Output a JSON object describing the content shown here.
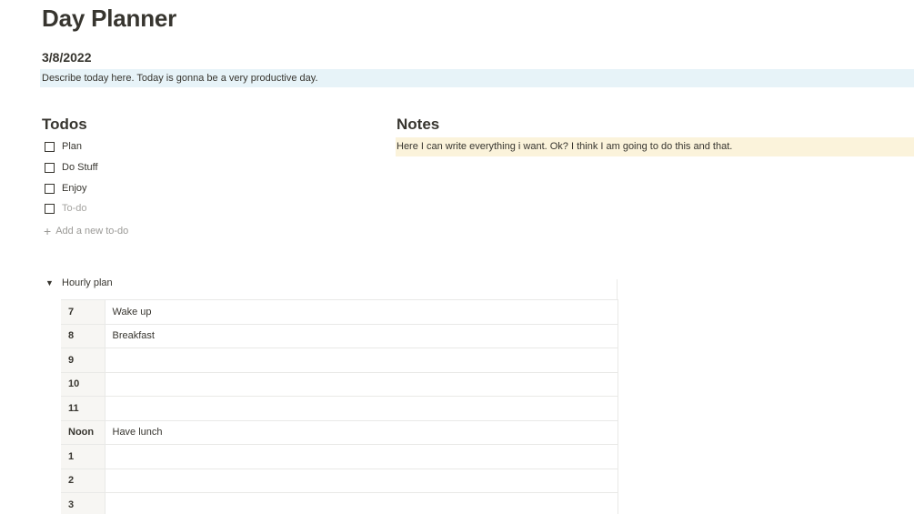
{
  "page": {
    "title": "Day Planner",
    "date": "3/8/2022",
    "description": "Describe today here. Today is gonna be a very productive day."
  },
  "todos": {
    "heading": "Todos",
    "items": [
      {
        "label": "Plan",
        "checked": false
      },
      {
        "label": "Do Stuff",
        "checked": false
      },
      {
        "label": "Enjoy",
        "checked": false
      }
    ],
    "placeholder": "To-do",
    "add_label": "Add a new to-do",
    "add_icon": "plus-icon"
  },
  "notes": {
    "heading": "Notes",
    "text": "Here I can write everything i want. Ok? I think I am going to do this and that."
  },
  "hourly": {
    "toggle_label": "Hourly plan",
    "toggle_state": "expanded",
    "rows": [
      {
        "hour": "7",
        "task": "Wake up"
      },
      {
        "hour": "8",
        "task": "Breakfast"
      },
      {
        "hour": "9",
        "task": ""
      },
      {
        "hour": "10",
        "task": ""
      },
      {
        "hour": "11",
        "task": ""
      },
      {
        "hour": "Noon",
        "task": "Have lunch"
      },
      {
        "hour": "1",
        "task": ""
      },
      {
        "hour": "2",
        "task": ""
      },
      {
        "hour": "3",
        "task": ""
      }
    ]
  },
  "colors": {
    "description_bg": "#e7f3f8",
    "notes_bg": "#fbf3db",
    "hour_cell_bg": "#f7f6f3",
    "text": "#37352f"
  }
}
